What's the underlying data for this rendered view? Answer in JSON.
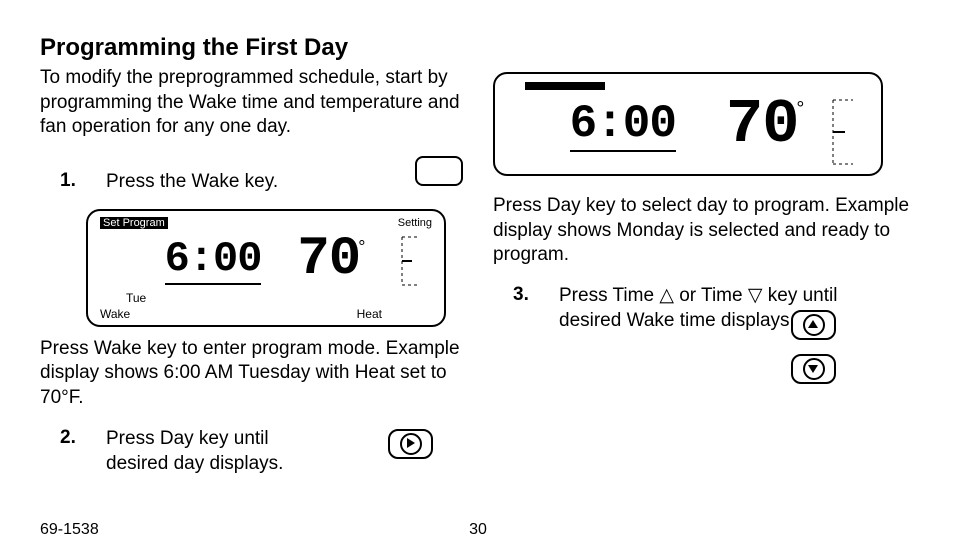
{
  "heading": "Programming the First Day",
  "intro": "To modify the preprogrammed schedule, start by programming the Wake time and temper­ature and fan operation for any one day.",
  "steps": {
    "s1": {
      "num": "1.",
      "text": "Press the Wake key."
    },
    "s2": {
      "num": "2.",
      "text": "Press Day key until desired day displays."
    },
    "s3": {
      "num": "3.",
      "text_a": "Press Time ",
      "tri_up": "△",
      "text_b": " or Time ",
      "tri_down": "▽",
      "text_c": " key until desired Wake time displays."
    }
  },
  "caption1": "Press Wake key to enter program mode. Example display shows 6:00 AM Tuesday with Heat set to 70°F.",
  "caption2": "Press Day key to select day to program. Example display shows Monday is selected and ready to program.",
  "lcd1": {
    "chip": "Set Program",
    "setting": "Setting",
    "time": "6:00",
    "temp": "70",
    "deg": "°",
    "day": "Tue",
    "wake": "Wake",
    "heat": "Heat"
  },
  "lcd2": {
    "time": "6:00",
    "temp": "70",
    "deg": "°"
  },
  "footer": {
    "doc": "69-1538",
    "page": "30"
  }
}
